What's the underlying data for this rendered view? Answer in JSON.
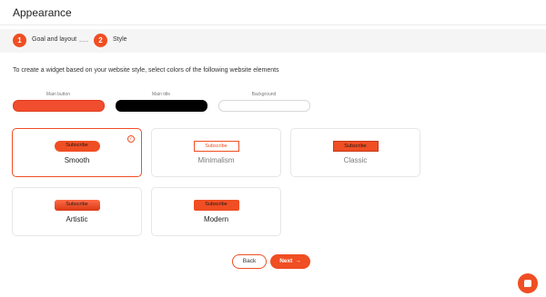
{
  "header": {
    "title": "Appearance"
  },
  "stepper": {
    "steps": [
      {
        "number": "1",
        "label": "Goal and layout"
      },
      {
        "number": "2",
        "label": "Style"
      }
    ]
  },
  "intro": "To create a widget based on your website style, select colors of the following website elements",
  "colors": {
    "labels": {
      "main_button": "Main button",
      "main_title": "Main title",
      "background": "Background"
    },
    "values": {
      "main_button": "#f04e2e",
      "main_title": "#000000",
      "background": "#ffffff"
    }
  },
  "styles": {
    "preview_label": "Subscribe",
    "cards": [
      {
        "name": "Smooth",
        "selected": true
      },
      {
        "name": "Minimalism",
        "selected": false
      },
      {
        "name": "Classic",
        "selected": false
      },
      {
        "name": "Artistic",
        "selected": false
      },
      {
        "name": "Modern",
        "selected": false
      }
    ]
  },
  "footer": {
    "back_label": "Back",
    "next_label": "Next",
    "next_icon": "arrow-right-icon"
  },
  "accent": "#f04e23"
}
